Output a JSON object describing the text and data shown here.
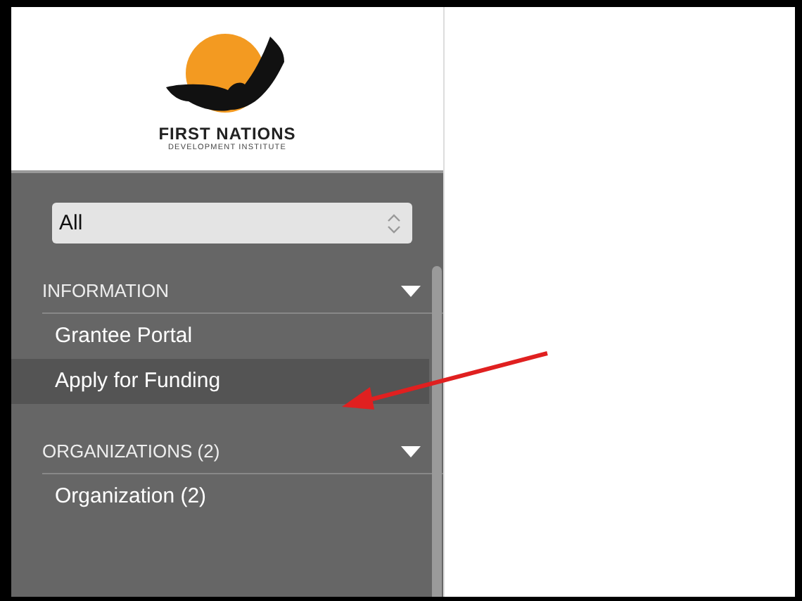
{
  "logo": {
    "name": "FIRST NATIONS",
    "subtitle": "DEVELOPMENT INSTITUTE"
  },
  "filter": {
    "value": "All"
  },
  "sections": [
    {
      "title": "INFORMATION",
      "expanded": true,
      "items": [
        {
          "label": "Grantee Portal",
          "selected": false
        },
        {
          "label": "Apply for Funding",
          "selected": true
        }
      ]
    },
    {
      "title": "ORGANIZATIONS (2)",
      "expanded": true,
      "items": [
        {
          "label": "Organization  (2)",
          "selected": false
        }
      ]
    }
  ]
}
